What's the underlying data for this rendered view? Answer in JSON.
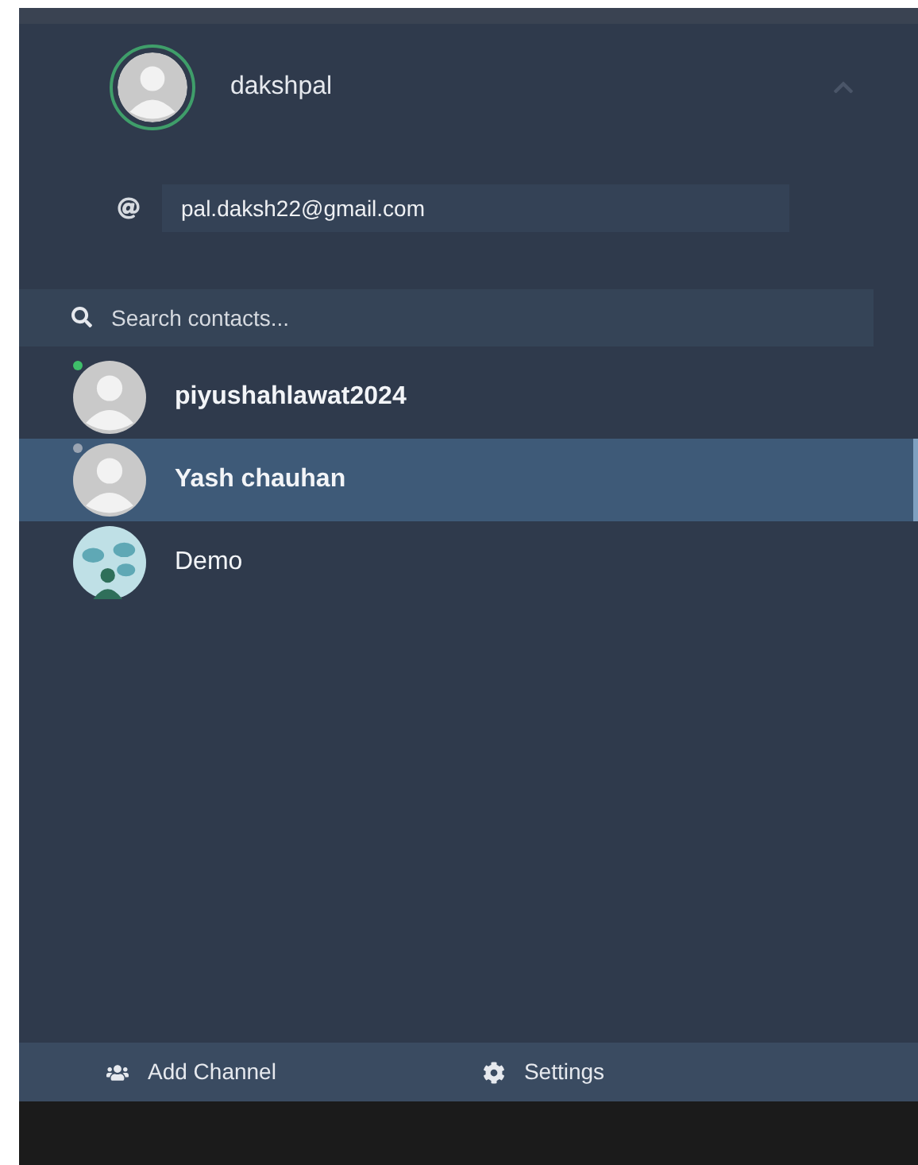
{
  "profile": {
    "username": "dakshpal",
    "expanded": true,
    "email": "pal.daksh22@gmail.com"
  },
  "search": {
    "placeholder": "Search contacts..."
  },
  "contacts": [
    {
      "name": "piyushahlawat2024",
      "kind": "user",
      "online": true,
      "selected": false
    },
    {
      "name": "Yash chauhan",
      "kind": "user",
      "online": false,
      "selected": true
    },
    {
      "name": "Demo",
      "kind": "group",
      "selected": false
    }
  ],
  "footer": [
    {
      "label": "Add Channel",
      "kind": "add-channel"
    },
    {
      "label": "Settings",
      "kind": "settings"
    }
  ]
}
